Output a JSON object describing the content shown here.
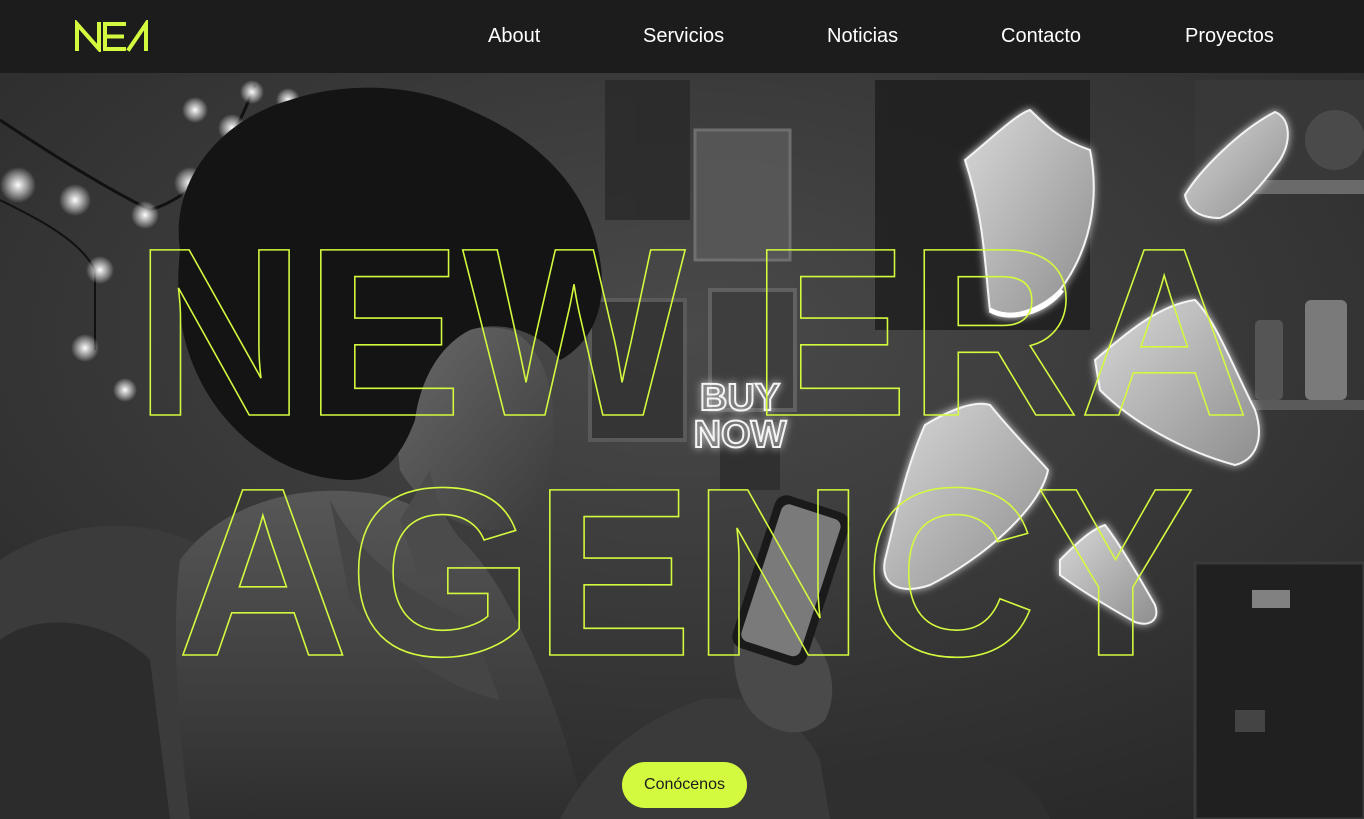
{
  "brand": {
    "logo_text": "NEA",
    "accent_color": "#d4fa3f"
  },
  "nav": {
    "items": [
      "About",
      "Servicios",
      "Noticias",
      "Contacto",
      "Proyectos"
    ]
  },
  "hero": {
    "headline_line1": "NEW ERA",
    "headline_line2": "AGENCY",
    "neon_sign_line1": "BUY",
    "neon_sign_line2": "NOW",
    "cta_label": "Conócenos"
  }
}
